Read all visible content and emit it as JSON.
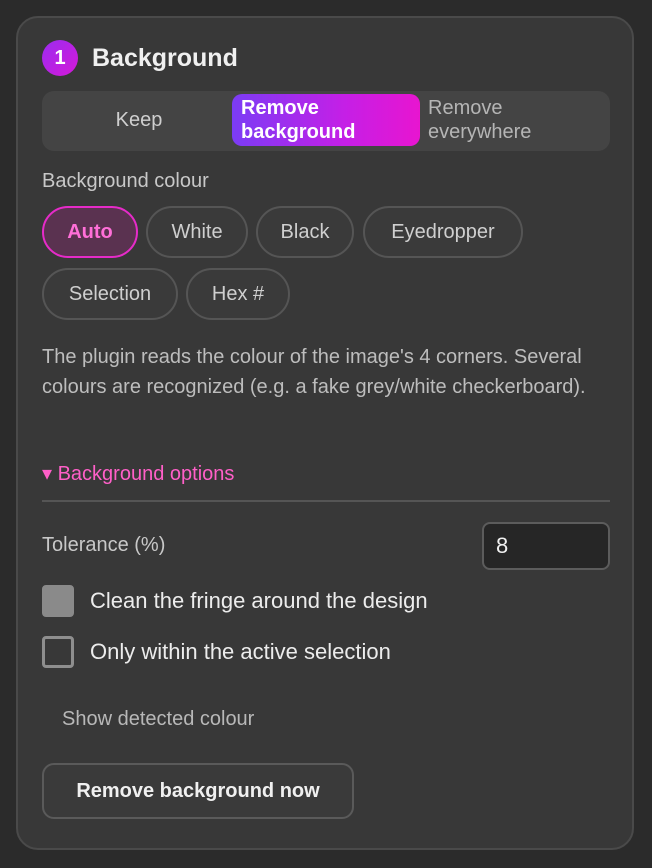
{
  "panel": {
    "step_number": "1",
    "title": "Background"
  },
  "mode_tabs": {
    "keep": "Keep",
    "remove_background": "Remove background",
    "remove_everywhere": "Remove everywhere",
    "selected": "remove_background"
  },
  "background_colour": {
    "label": "Background colour",
    "options": [
      "Auto",
      "White",
      "Black",
      "Eyedropper",
      "Selection",
      "Hex #"
    ],
    "selected": "Auto",
    "help_text": "The plugin reads the colour of the image's 4 corners. Several colours are recognized (e.g. a fake grey/white checkerboard)."
  },
  "options_section": {
    "toggle_label": "▾ Background options",
    "tolerance_label": "Tolerance (%)",
    "tolerance_value": "8",
    "clean_fringe_label": "Clean the fringe around the design",
    "clean_fringe_checked": true,
    "active_selection_label": "Only within the active selection",
    "active_selection_checked": false
  },
  "actions": {
    "show_detected_colour": "Show detected colour",
    "remove_now": "Remove background now"
  },
  "colors": {
    "accent_gradient_start": "#7b3cf5",
    "accent_gradient_end": "#e815d0",
    "accent_pink": "#ff5fc8",
    "panel_bg": "#383838",
    "page_bg": "#2b2b2b"
  }
}
